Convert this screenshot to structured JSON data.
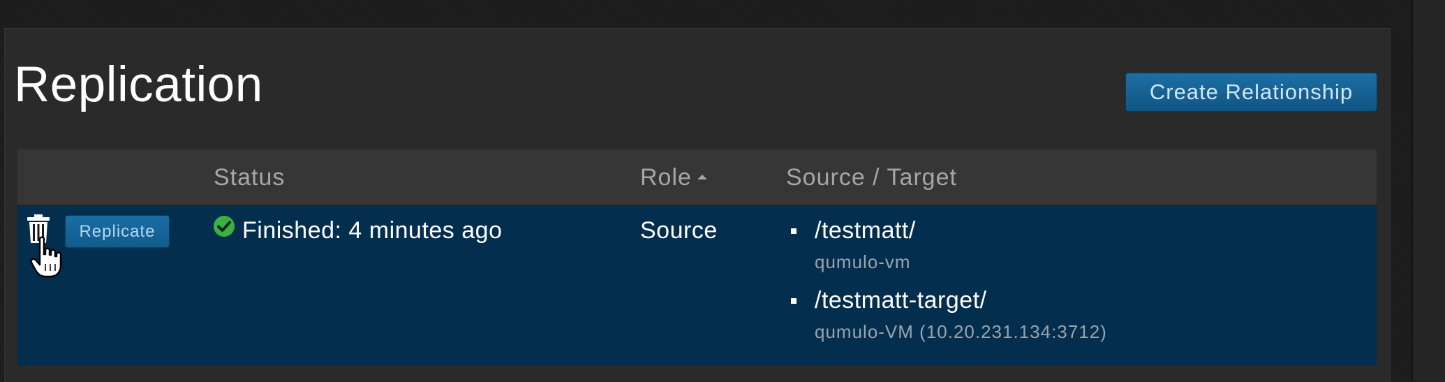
{
  "page": {
    "title": "Replication",
    "create_button_label": "Create Relationship"
  },
  "table": {
    "columns": [
      {
        "label": ""
      },
      {
        "label": "Status"
      },
      {
        "label": "Role",
        "sorted": "ascending"
      },
      {
        "label": "Source / Target"
      }
    ],
    "rows": [
      {
        "actions": {
          "delete_icon": "trash-icon",
          "replicate_label": "Replicate"
        },
        "status": {
          "icon": "check-circle-icon",
          "icon_color": "#3cb043",
          "text": "Finished: 4 minutes ago"
        },
        "role": "Source",
        "endpoints": [
          {
            "path": "/testmatt/",
            "host": "qumulo-vm"
          },
          {
            "path": "/testmatt-target/",
            "host": "qumulo-VM (10.20.231.134:3712)"
          }
        ]
      }
    ]
  },
  "colors": {
    "accent_button": "#1a6da4",
    "selected_row": "#032e4e",
    "panel": "#2a2a2a",
    "header": "#363636"
  },
  "cursor": "hand-pointer"
}
